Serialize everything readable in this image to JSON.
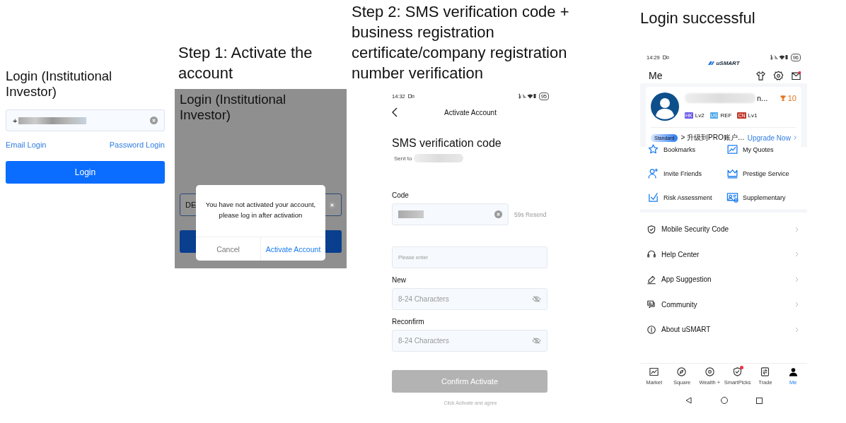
{
  "login_screen": {
    "title": "Login (Institutional Investor)",
    "phone_prefix": "+",
    "links": [
      "Email Login",
      "Password Login"
    ],
    "button": "Login"
  },
  "step_1": {
    "caption": "Step 1: Activate the account",
    "title": "Login (Institutional Investor)",
    "field_value": "DE",
    "message": "You have not activated your account, please log in after activation",
    "buttons": [
      "Cancel",
      "Activate Account"
    ]
  },
  "step_2": {
    "caption": "Step 2: SMS verification code + business registration certificate/company registration number verification",
    "status_time": "14:32",
    "battery": "95",
    "nav_title": "Activate Account",
    "heading": "SMS verification code",
    "sent_to": "Sent to",
    "code_label": "Code",
    "resend": "59s Resend",
    "fields": [
      {
        "placeholder": "Please enter"
      },
      {
        "label": "New",
        "placeholder": "8-24 Characters"
      },
      {
        "label": "Reconfirm",
        "placeholder": "8-24 Characters"
      }
    ],
    "confirm_button": {
      "label": "Confirm Activate",
      "disabled": true
    },
    "footer": "Click Activate and agree"
  },
  "result": {
    "caption": "Login successful",
    "status_time": "14:29",
    "battery": "96",
    "logo": "uSMART",
    "title": "Me",
    "name_tail": "n...",
    "points": "10",
    "markets": [
      {
        "tag": "HK",
        "level": "Lv2",
        "color": "#6c5ce7"
      },
      {
        "tag": "US",
        "level": "REF",
        "color": "#4da6e8"
      },
      {
        "tag": "CN",
        "level": "Lv1",
        "color": "#c0392b"
      }
    ],
    "tier": "Standard",
    "promo": "> 升级到PRO账户…",
    "upgrade": "Upgrade Now",
    "shortcuts": [
      "Bookmarks",
      "My Quotes",
      "Invite Friends",
      "Prestige Service",
      "Risk Assessment",
      "Supplementary"
    ],
    "menu": [
      "Mobile Security Code",
      "Help Center",
      "App Suggestion",
      "Community",
      "About uSMART"
    ],
    "tabs": [
      {
        "label": "Market",
        "selected": false,
        "badge": false
      },
      {
        "label": "Square",
        "selected": false,
        "badge": false
      },
      {
        "label": "Wealth +",
        "selected": false,
        "badge": false
      },
      {
        "label": "SmartPicks",
        "selected": false,
        "badge": true
      },
      {
        "label": "Trade",
        "selected": false,
        "badge": false
      },
      {
        "label": "Me",
        "selected": true,
        "badge": false
      }
    ]
  }
}
